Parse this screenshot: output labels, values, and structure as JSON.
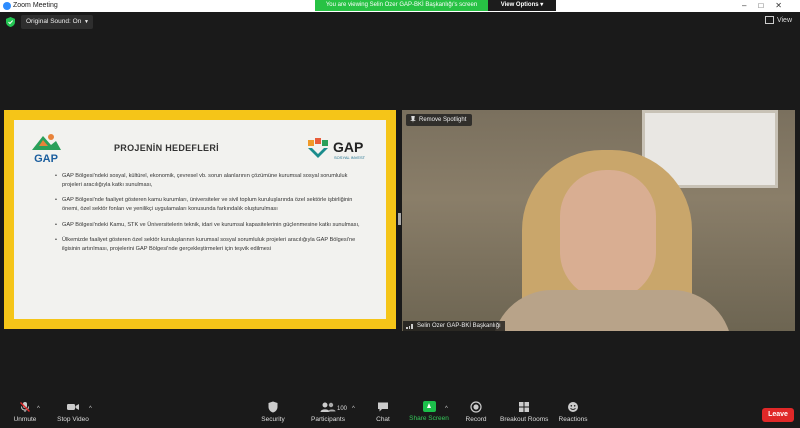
{
  "window": {
    "title": "Zoom Meeting"
  },
  "banner": {
    "viewing_text": "You are viewing Selin Ozer GAP-BKİ Başkanlığı's screen",
    "view_options": "View Options"
  },
  "topbar": {
    "original_sound": "Original Sound: On",
    "view": "View"
  },
  "slide": {
    "title": "PROJENİN HEDEFLERİ",
    "logo_left": "GAP",
    "logo_right_main": "GAP",
    "logo_right_sub": "SOSYAL INVEST",
    "bullets": [
      "GAP Bölgesi'ndeki sosyal, kültürel, ekonomik, çevresel vb. sorun alanlarının çözümüne kurumsal sosyal sorumluluk projeleri aracılığıyla katkı sunulması,",
      "GAP Bölgesi'nde faaliyet gösteren kamu kurumları, üniversiteler ve sivil toplum kuruluşlarında özel sektörle işbirliğinin önemi, özel sektör fonları ve yenilikçi uygulamaları konusunda farkındalık oluşturulması",
      "GAP Bölgesi'ndeki Kamu, STK ve Üniversitelerin teknik, idari ve kurumsal kapasitelerinin güçlenmesine katkı sunulması,",
      "Ülkemizde faaliyet gösteren özel sektör kuruluşlarının kurumsal sosyal sorumluluk projeleri aracılığıyla GAP Bölgesi'ne ilgisinin artırılması, projelerini GAP Bölgesi'nde gerçekleştirmeleri için teşvik edilmesi"
    ]
  },
  "video": {
    "remove_spotlight": "Remove Spotlight",
    "participant_name": "Selin Ozer GAP-BKİ Başkanlığı"
  },
  "toolbar": {
    "unmute": "Unmute",
    "stop_video": "Stop Video",
    "security": "Security",
    "participants": "Participants",
    "participants_count": "100",
    "chat": "Chat",
    "share_screen": "Share Screen",
    "record": "Record",
    "breakout_rooms": "Breakout Rooms",
    "reactions": "Reactions",
    "leave": "Leave"
  },
  "colors": {
    "share_border": "#f5c518",
    "banner_green": "#27c244",
    "leave_red": "#e02828",
    "accent_green": "#1cbf4b"
  }
}
